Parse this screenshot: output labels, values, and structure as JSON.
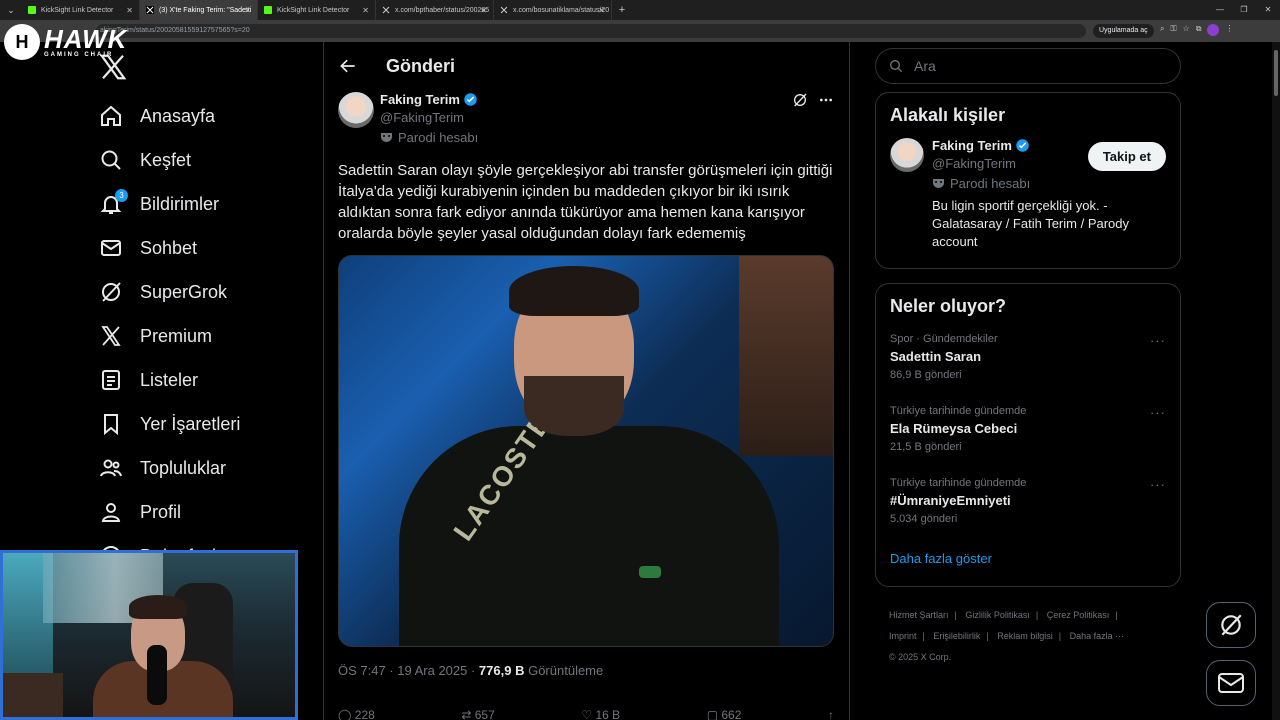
{
  "browser": {
    "tabs": [
      {
        "title": "KickSight Link Detector",
        "active": false
      },
      {
        "title": "(3) X'te Faking Terim: \"Sadetti",
        "active": true
      },
      {
        "title": "KickSight Link Detector",
        "active": false
      },
      {
        "title": "x.com/bpthaber/status/200265",
        "active": false
      },
      {
        "title": "x.com/bosunatiklama/status/20",
        "active": false
      }
    ],
    "url": "akingTerim/status/2002058155912757565?s=20",
    "open_app_label": "Uygulamada aç"
  },
  "overlay": {
    "logo_big": "HAWK",
    "logo_small": "GAMING CHAIR"
  },
  "nav": {
    "items": [
      {
        "label": "Anasayfa",
        "icon": "home-icon"
      },
      {
        "label": "Keşfet",
        "icon": "search-icon"
      },
      {
        "label": "Bildirimler",
        "icon": "bell-icon",
        "badge": "3"
      },
      {
        "label": "Sohbet",
        "icon": "mail-icon"
      },
      {
        "label": "SuperGrok",
        "icon": "grok-icon"
      },
      {
        "label": "Premium",
        "icon": "x-icon"
      },
      {
        "label": "Listeler",
        "icon": "list-icon"
      },
      {
        "label": "Yer İşaretleri",
        "icon": "bookmark-icon"
      },
      {
        "label": "Topluluklar",
        "icon": "people-icon"
      },
      {
        "label": "Profil",
        "icon": "person-icon"
      },
      {
        "label": "Daha fazla",
        "icon": "more-icon"
      }
    ]
  },
  "center": {
    "title": "Gönderi"
  },
  "post": {
    "author_name": "Faking Terim",
    "handle": "@FakingTerim",
    "parody_label": "Parodi hesabı",
    "text": "Sadettin Saran olayı şöyle gerçekleşiyor abi transfer görüşmeleri için gittiği İtalya'da yediği kurabiyenin içinden bu maddeden çıkıyor bir iki ısırık aldıktan sonra fark ediyor anında tükürüyor ama hemen kana karışıyor oralarda böyle şeyler yasal olduğundan dolayı fark edememiş",
    "media_shirt_text": "LACOSTE",
    "time": "ÖS 7:47 · 19 Ara 2025 · ",
    "views_count": "776,9 B",
    "views_label": "Görüntüleme",
    "stats": {
      "replies": "228",
      "reposts": "657",
      "likes": "16 B",
      "bookmarks": "662"
    }
  },
  "search": {
    "placeholder": "Ara"
  },
  "related": {
    "title": "Alakalı kişiler",
    "name": "Faking Terim",
    "handle": "@FakingTerim",
    "parody_label": "Parodi hesabı",
    "bio": "Bu ligin sportif gerçekliği yok. - Galatasaray / Fatih Terim / Parody account",
    "follow_label": "Takip et"
  },
  "trends": {
    "title": "Neler oluyor?",
    "items": [
      {
        "context": "Spor · Gündemdekiler",
        "name": "Sadettin Saran",
        "count": "86,9 B gönderi"
      },
      {
        "context": "Türkiye tarihinde gündemde",
        "name": "Ela Rümeysa Cebeci",
        "count": "21,5 B gönderi"
      },
      {
        "context": "Türkiye tarihinde gündemde",
        "name": "#ÜmraniyeEmniyeti",
        "count": "5.034 gönderi"
      }
    ],
    "show_more": "Daha fazla göster"
  },
  "footer": {
    "links": [
      "Hizmet Şartları",
      "|",
      "Gizlilik Politikası",
      "|",
      "Çerez Politikası",
      "|",
      "Imprint",
      "|",
      "Erişilebilirlik",
      "|",
      "Reklam bilgisi",
      "|",
      "Daha fazla ···"
    ],
    "copyright": "© 2025 X Corp."
  },
  "colors": {
    "accent": "#1d9bf0",
    "background": "#000000",
    "border": "#2f3336",
    "muted_text": "#71767b",
    "webcam_border": "#2f6fd6"
  }
}
